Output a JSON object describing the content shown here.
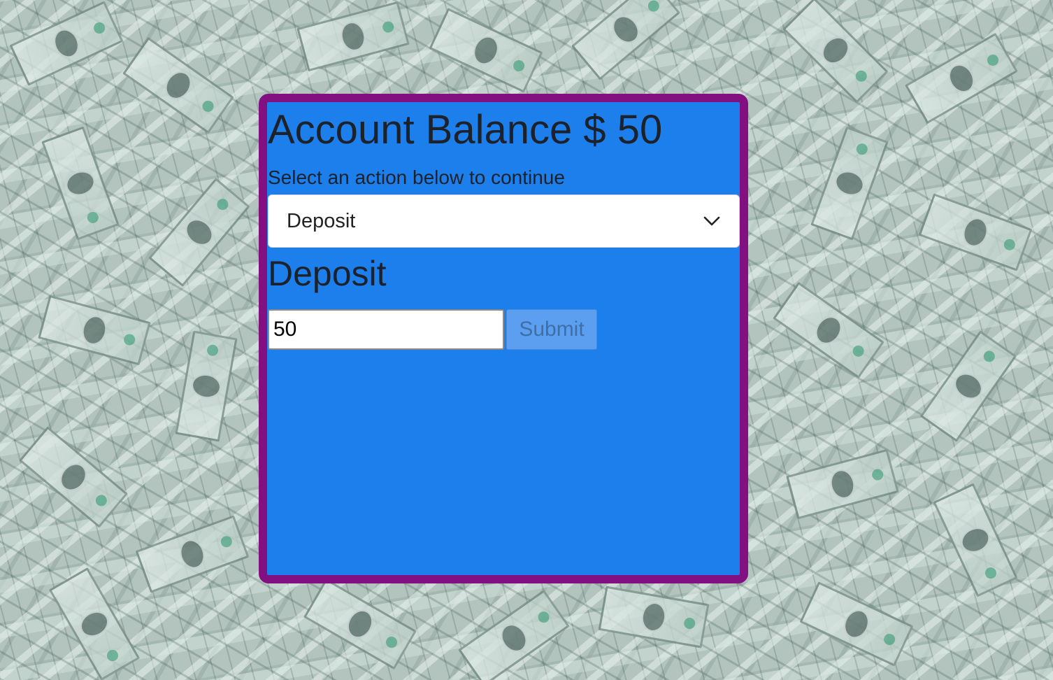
{
  "account": {
    "balance_title": "Account Balance $ 50",
    "balance_value": 50,
    "subtitle": "Select an action below to continue"
  },
  "action_select": {
    "selected": "Deposit",
    "icon": "chevron-down-icon"
  },
  "section": {
    "title": "Deposit"
  },
  "form": {
    "amount_value": "50",
    "submit_label": "Submit"
  },
  "colors": {
    "card_bg": "#1c7fec",
    "card_border": "#831081",
    "submit_disabled": "#5c9ff0",
    "text": "#1d2129"
  }
}
